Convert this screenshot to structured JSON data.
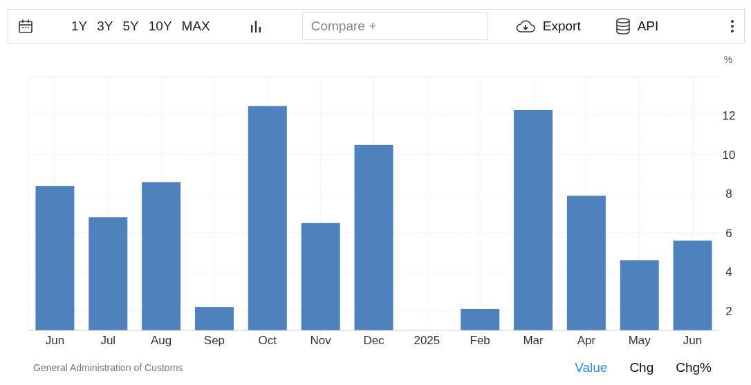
{
  "toolbar": {
    "ranges": [
      {
        "label": "1Y",
        "selected": false
      },
      {
        "label": "3Y",
        "selected": false
      },
      {
        "label": "5Y",
        "selected": false
      },
      {
        "label": "10Y",
        "selected": false
      },
      {
        "label": "MAX",
        "selected": false
      }
    ],
    "compare": {
      "placeholder": "Compare +"
    },
    "export": "Export",
    "api": "API"
  },
  "chart": {
    "unit": "%",
    "chart_data": {
      "type": "bar",
      "categories": [
        "Jun",
        "Jul",
        "Aug",
        "Sep",
        "Oct",
        "Nov",
        "Dec",
        "2025",
        "Feb",
        "Mar",
        "Apr",
        "May",
        "Jun"
      ],
      "grid": true,
      "series": [
        {
          "color": "#4f81bd",
          "values": [
            8.4,
            6.8,
            8.6,
            2.2,
            12.5,
            6.5,
            10.5,
            null,
            2.1,
            12.3,
            7.9,
            4.6,
            5.6
          ]
        }
      ],
      "ylim": [
        1,
        14
      ],
      "yticks": [
        2,
        4,
        6,
        8,
        10,
        12
      ]
    }
  },
  "footer": {
    "source": "General Administration of Customs",
    "views": [
      {
        "label": "Value",
        "selected": true
      },
      {
        "label": "Chg",
        "selected": false
      },
      {
        "label": "Chg%",
        "selected": false
      }
    ]
  }
}
